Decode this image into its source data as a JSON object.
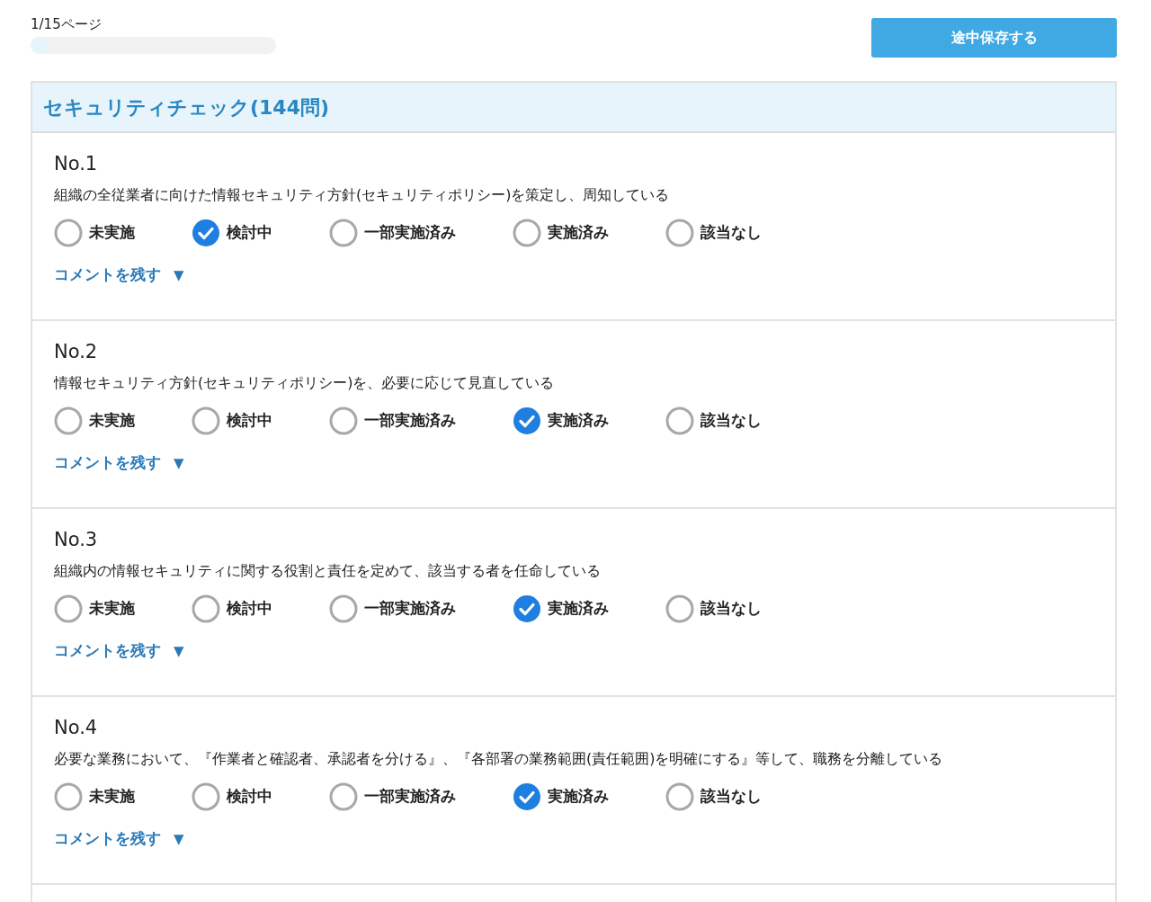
{
  "progress": {
    "label": "1/15ページ",
    "level": 0.07
  },
  "save_button": "途中保存する",
  "section": {
    "title": "セキュリティチェック(144問)"
  },
  "questions": [
    {
      "number": "No.1",
      "text": "組織の全従業者に向けた情報セキュリティ方針(セキュリティポリシー)を策定し、周知している",
      "options": [
        {
          "label": "未実施",
          "selected": false
        },
        {
          "label": "検討中",
          "selected": true
        },
        {
          "label": "一部実施済み",
          "selected": false
        },
        {
          "label": "実施済み",
          "selected": false
        },
        {
          "label": "該当なし",
          "selected": false
        }
      ],
      "comment": {
        "label": "コメントを残す",
        "arrow": "▼",
        "expanded": false
      }
    },
    {
      "number": "No.2",
      "text": "情報セキュリティ方針(セキュリティポリシー)を、必要に応じて見直している",
      "options": [
        {
          "label": "未実施",
          "selected": false
        },
        {
          "label": "検討中",
          "selected": false
        },
        {
          "label": "一部実施済み",
          "selected": false
        },
        {
          "label": "実施済み",
          "selected": true
        },
        {
          "label": "該当なし",
          "selected": false
        }
      ],
      "comment": {
        "label": "コメントを残す",
        "arrow": "▼",
        "expanded": false
      }
    },
    {
      "number": "No.3",
      "text": "組織内の情報セキュリティに関する役割と責任を定めて、該当する者を任命している",
      "options": [
        {
          "label": "未実施",
          "selected": false
        },
        {
          "label": "検討中",
          "selected": false
        },
        {
          "label": "一部実施済み",
          "selected": false
        },
        {
          "label": "実施済み",
          "selected": true
        },
        {
          "label": "該当なし",
          "selected": false
        }
      ],
      "comment": {
        "label": "コメントを残す",
        "arrow": "▼",
        "expanded": false
      }
    },
    {
      "number": "No.4",
      "text": "必要な業務において、『作業者と確認者、承認者を分ける』、『各部署の業務範囲(責任範囲)を明確にする』等して、職務を分離している",
      "options": [
        {
          "label": "未実施",
          "selected": false
        },
        {
          "label": "検討中",
          "selected": false
        },
        {
          "label": "一部実施済み",
          "selected": false
        },
        {
          "label": "実施済み",
          "selected": true
        },
        {
          "label": "該当なし",
          "selected": false
        }
      ],
      "comment": {
        "label": "コメントを残す",
        "arrow": "▼",
        "expanded": false
      }
    }
  ]
}
